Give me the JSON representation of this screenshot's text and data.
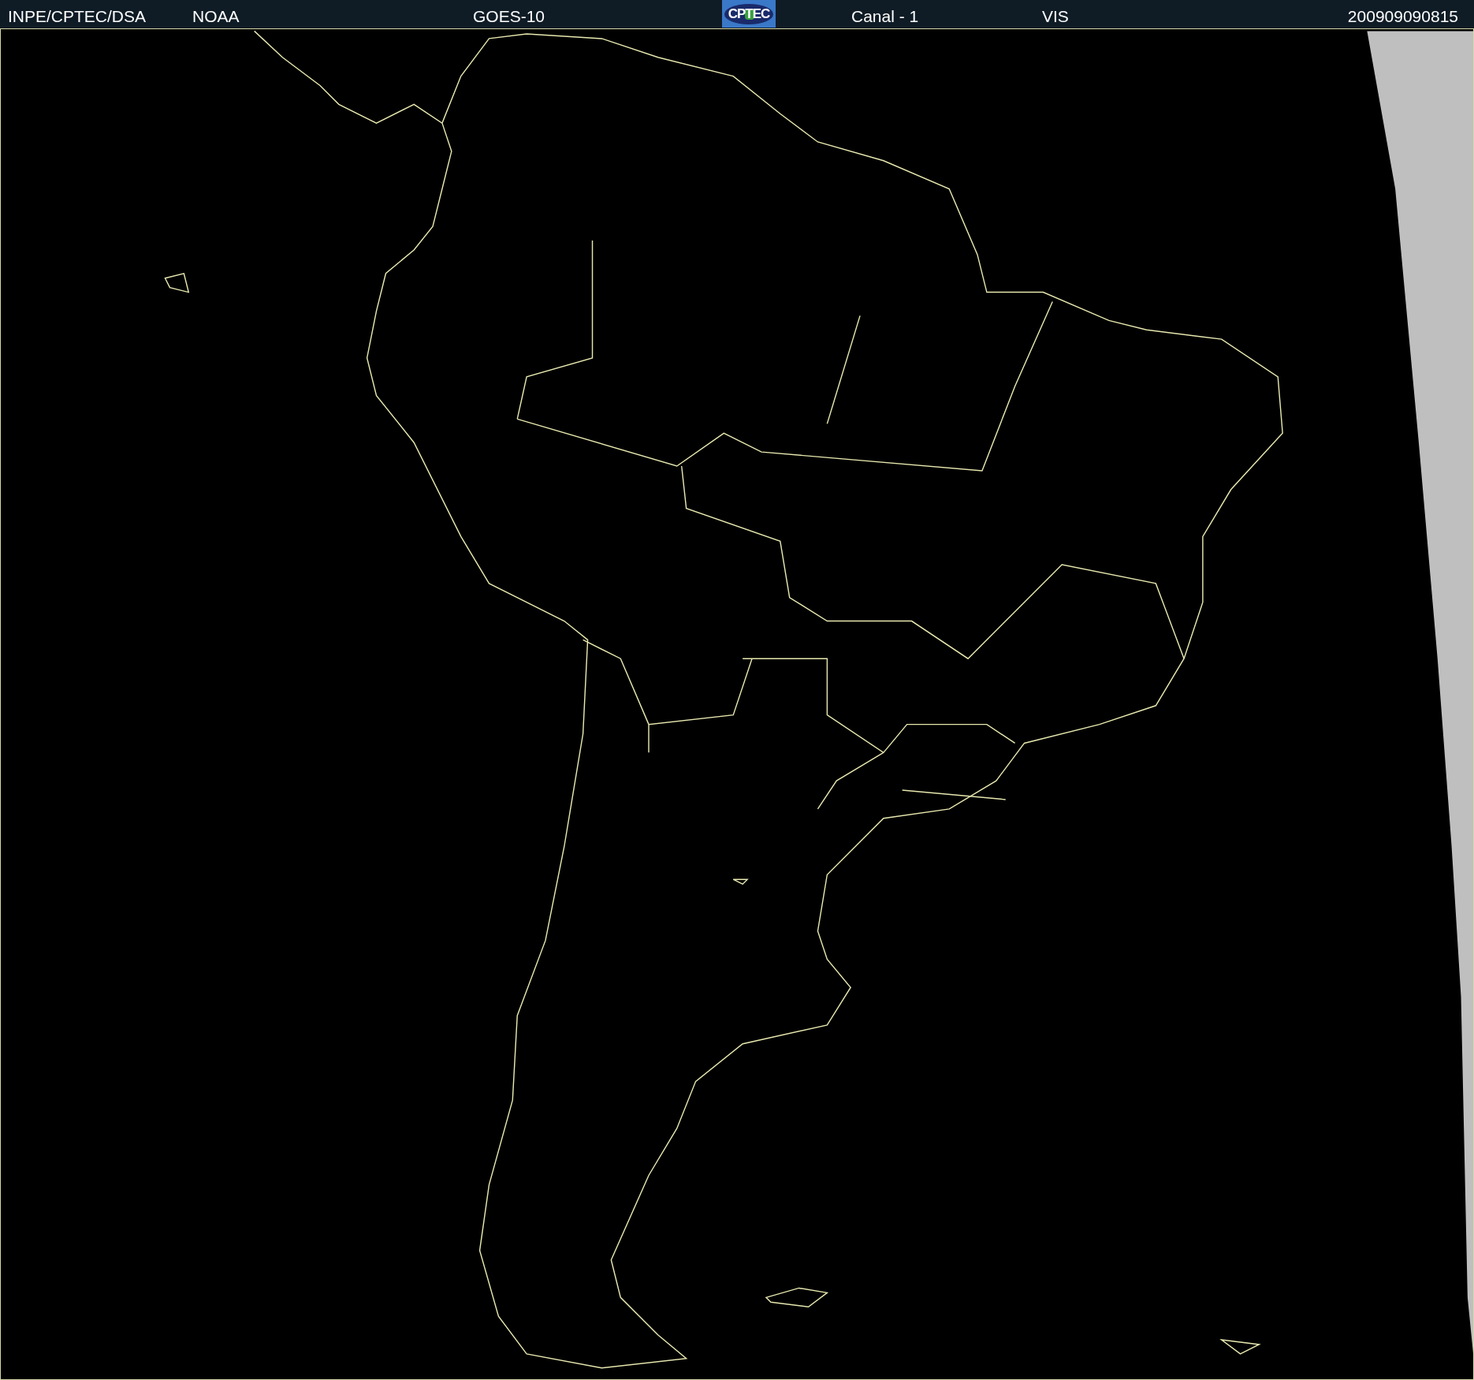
{
  "header": {
    "agency": "INPE/CPTEC/DSA",
    "source": "NOAA",
    "satellite": "GOES-10",
    "logo": "CPTEC",
    "channel": "Canal - 1",
    "band": "VIS",
    "timestamp": "200909090815"
  }
}
